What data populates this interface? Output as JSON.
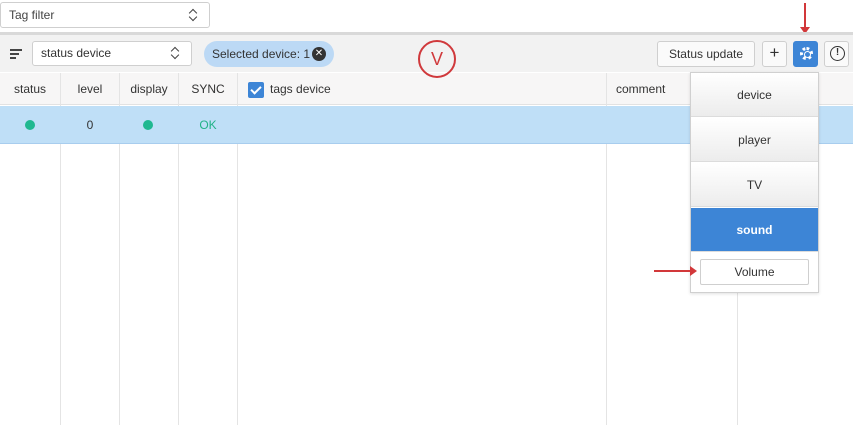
{
  "tag_filter": {
    "placeholder": "Tag filter"
  },
  "toolbar": {
    "status_select_value": "status device",
    "selected_chip_label": "Selected device: 1",
    "status_update_label": "Status update",
    "add_label": "+",
    "info_label": "!"
  },
  "table": {
    "columns": [
      "status",
      "level",
      "display",
      "SYNC",
      "tags device",
      "comment"
    ],
    "rows": [
      {
        "status": "green-dot",
        "level": "0",
        "display": "green-dot",
        "sync": "OK",
        "tags_device": "",
        "comment": ""
      }
    ]
  },
  "annotation": {
    "mark": "V"
  },
  "dropdown": {
    "options": [
      "device",
      "player",
      "TV",
      "sound"
    ],
    "active": "sound",
    "volume_label": "Volume"
  },
  "colors": {
    "accent": "#3d85d6",
    "selected_row": "#bfdff7",
    "status_ok": "#1fb890",
    "annotation": "#d0393c"
  }
}
